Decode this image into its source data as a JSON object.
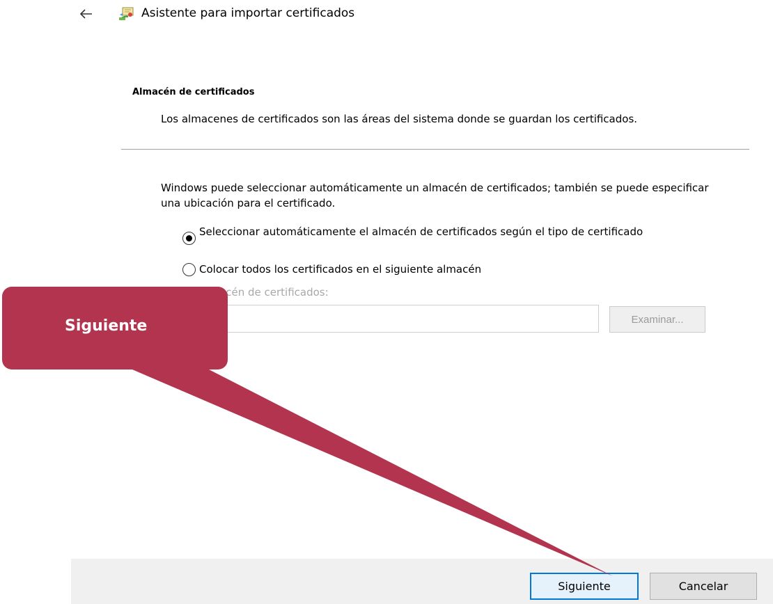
{
  "header": {
    "back_icon": "arrow-left-icon",
    "wizard_icon": "certificate-import-icon",
    "title": "Asistente para importar certificados"
  },
  "section": {
    "title": "Almacén de certificados",
    "description": "Los almacenes de certificados son las áreas del sistema donde se guardan los certificados."
  },
  "body": {
    "intro": "Windows puede seleccionar automáticamente un almacén de certificados; también se puede especificar una ubicación para el certificado.",
    "options": [
      {
        "label": "Seleccionar automáticamente el almacén de certificados según el tipo de certificado",
        "selected": true
      },
      {
        "label": "Colocar todos los certificados en el siguiente almacén",
        "selected": false
      }
    ],
    "store_label": "Almacén de certificados:",
    "store_value": "",
    "browse_label": "Examinar..."
  },
  "footer": {
    "next_label": "Siguiente",
    "cancel_label": "Cancelar"
  },
  "callout": {
    "text": "Siguiente",
    "color": "#b2344e"
  },
  "colors": {
    "accent": "#0078d7",
    "footer_bg": "#f0f0f0",
    "disabled_text": "#a8a8a8"
  }
}
